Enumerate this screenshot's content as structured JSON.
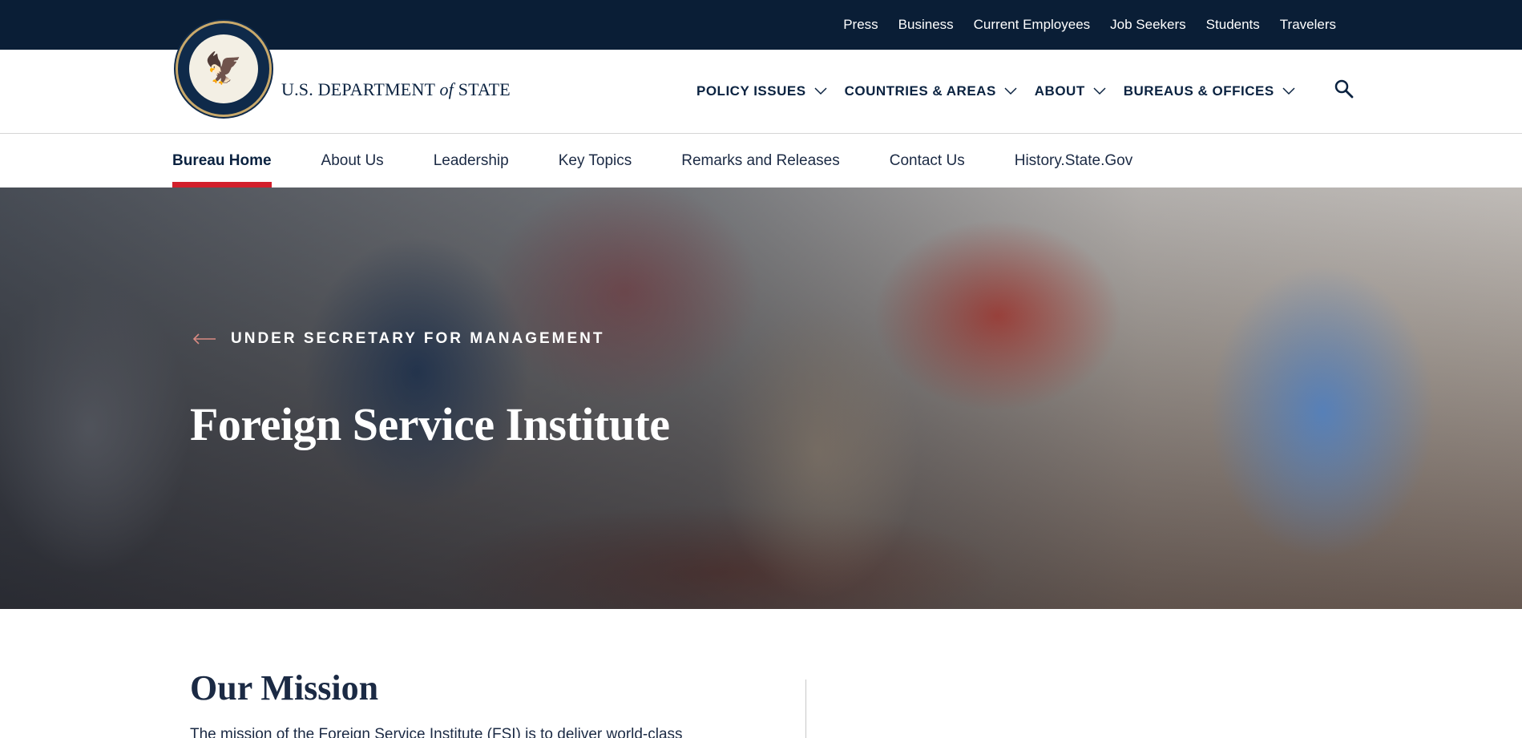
{
  "utility_nav": {
    "links": [
      "Press",
      "Business",
      "Current Employees",
      "Job Seekers",
      "Students",
      "Travelers"
    ]
  },
  "header": {
    "logo_text_before": "U.S. DEPARTMENT ",
    "logo_text_of": "of",
    "logo_text_after": " STATE",
    "seal_icon": "department-seal-icon"
  },
  "main_nav": {
    "items": [
      "POLICY ISSUES",
      "COUNTRIES & AREAS",
      "ABOUT",
      "BUREAUS & OFFICES"
    ],
    "search_icon": "search-icon"
  },
  "sub_nav": {
    "tabs": [
      "Bureau Home",
      "About Us",
      "Leadership",
      "Key Topics",
      "Remarks and Releases",
      "Contact Us",
      "History.State.Gov"
    ],
    "active_index": 0,
    "active_color": "#d21f2b"
  },
  "hero": {
    "back_label": "UNDER SECRETARY FOR MANAGEMENT",
    "title": "Foreign Service Institute"
  },
  "content": {
    "mission_title": "Our Mission",
    "mission_text": "The mission of the Foreign Service Institute (FSI) is to deliver world-class"
  },
  "colors": {
    "utility_bg": "#0a1e36",
    "navy": "#0a2240",
    "accent_red": "#d21f2b"
  }
}
